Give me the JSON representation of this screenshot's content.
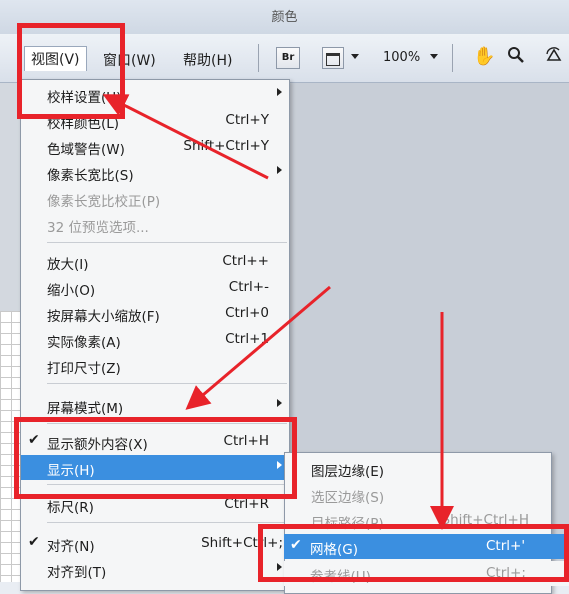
{
  "window": {
    "title": "颜色"
  },
  "menubar": {
    "view": "视图(V)",
    "window": "窗口(W)",
    "help": "帮助(H)",
    "br_button": "Br",
    "zoom": "100%"
  },
  "view_menu": {
    "items": [
      {
        "label": "校样设置(U)",
        "shortcut": "",
        "submenu": true
      },
      {
        "label": "校样颜色(L)",
        "shortcut": "Ctrl+Y"
      },
      {
        "label": "色域警告(W)",
        "shortcut": "Shift+Ctrl+Y"
      },
      {
        "label": "像素长宽比(S)",
        "shortcut": "",
        "submenu": true
      },
      {
        "label": "像素长宽比校正(P)",
        "shortcut": "",
        "disabled": true
      },
      {
        "label": "32 位预览选项...",
        "shortcut": "",
        "disabled": true
      },
      {
        "label": "放大(I)",
        "shortcut": "Ctrl++"
      },
      {
        "label": "缩小(O)",
        "shortcut": "Ctrl+-"
      },
      {
        "label": "按屏幕大小缩放(F)",
        "shortcut": "Ctrl+0"
      },
      {
        "label": "实际像素(A)",
        "shortcut": "Ctrl+1"
      },
      {
        "label": "打印尺寸(Z)",
        "shortcut": ""
      },
      {
        "label": "屏幕模式(M)",
        "shortcut": "",
        "submenu": true
      },
      {
        "label": "显示额外内容(X)",
        "shortcut": "Ctrl+H",
        "checked": true
      },
      {
        "label": "显示(H)",
        "shortcut": "",
        "submenu": true,
        "highlighted": true
      },
      {
        "label": "标尺(R)",
        "shortcut": "Ctrl+R"
      },
      {
        "label": "对齐(N)",
        "shortcut": "Shift+Ctrl+;",
        "checked": true
      },
      {
        "label": "对齐到(T)",
        "shortcut": "",
        "submenu": true
      }
    ]
  },
  "show_submenu": {
    "items": [
      {
        "label": "图层边缘(E)",
        "shortcut": ""
      },
      {
        "label": "选区边缘(S)",
        "shortcut": "",
        "disabled": true
      },
      {
        "label": "目标路径(P)",
        "shortcut": "Shift+Ctrl+H",
        "disabled": true
      }
    ]
  },
  "grid_submenu": {
    "items": [
      {
        "label": "网格(G)",
        "shortcut": "Ctrl+'",
        "checked": true,
        "highlighted": true
      },
      {
        "label": "参考线(U)",
        "shortcut": "Ctrl+;",
        "disabled": true
      }
    ]
  },
  "glyphs": {
    "check": "✔",
    "hand": "✋",
    "search": "🔍"
  },
  "colors": {
    "highlight": "#3b8fe0",
    "annotation": "#e8232a"
  }
}
